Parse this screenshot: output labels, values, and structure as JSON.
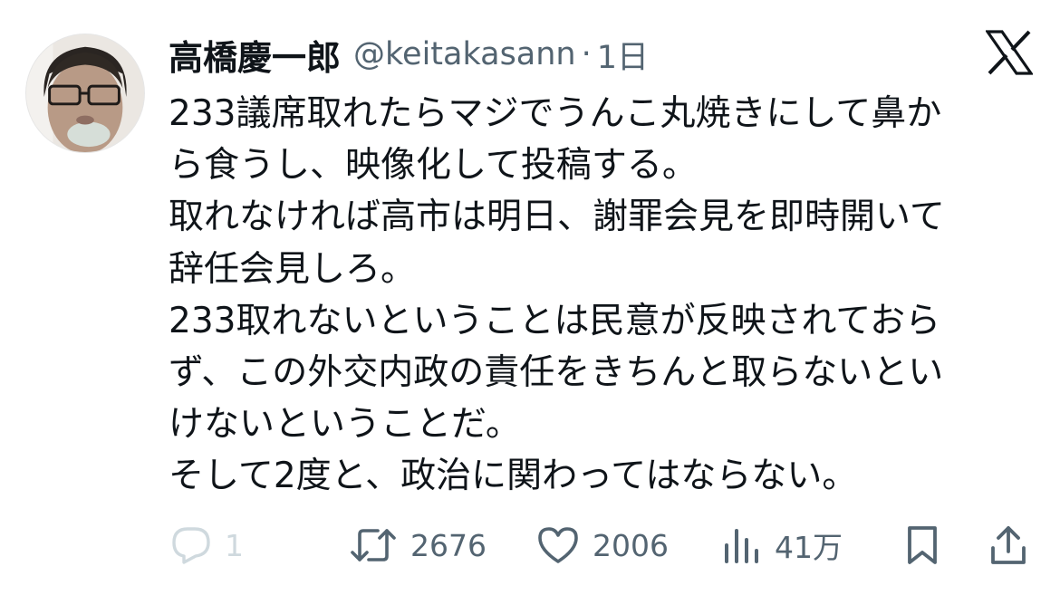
{
  "tweet": {
    "display_name": "高橋慶一郎",
    "handle": "@keitakasann",
    "separator": "·",
    "time": "1日",
    "text_lines": [
      "233議席取れたらマジでうんこ丸焼きにして鼻か",
      "ら食うし、映像化して投稿する。",
      "取れなければ高市は明日、謝罪会見を即時開いて",
      "辞任会見しろ。",
      "233取れないということは民意が反映されておら",
      "ず、この外交内政の責任をきちんと取らないとい",
      "けないということだ。",
      "そして2度と、政治に関わってはならない。"
    ]
  },
  "actions": {
    "reply_count": "1",
    "retweet_count": "2676",
    "like_count": "2006",
    "views_count": "41万"
  },
  "icons": {
    "brand": "x-logo-icon",
    "reply": "reply-icon",
    "retweet": "retweet-icon",
    "like": "heart-icon",
    "views": "views-icon",
    "bookmark": "bookmark-icon",
    "share": "share-icon"
  },
  "colors": {
    "text": "#0f1419",
    "secondary": "#536471",
    "disabled": "#cfd9de"
  }
}
